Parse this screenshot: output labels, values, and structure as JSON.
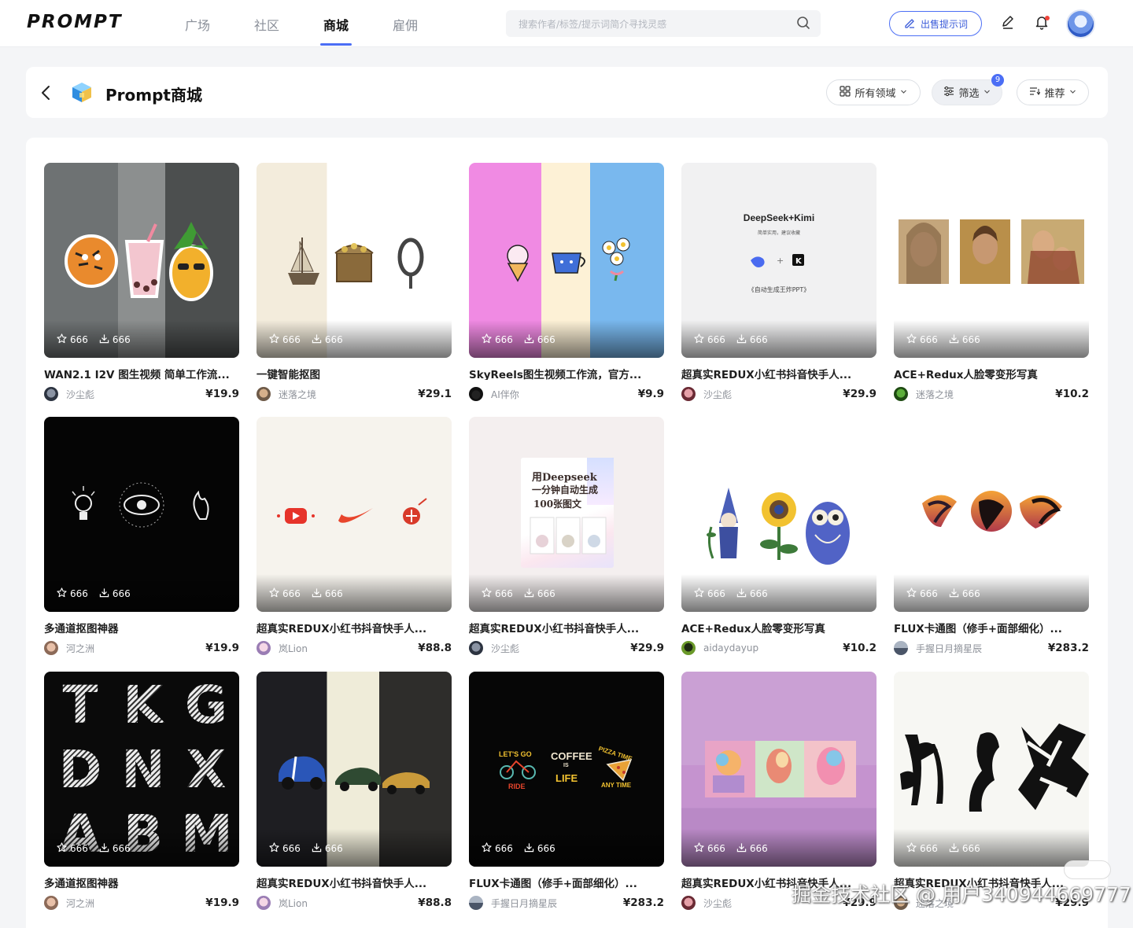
{
  "app": {
    "logo": "PROMPT"
  },
  "nav": {
    "tabs": [
      {
        "label": "广场",
        "active": false
      },
      {
        "label": "社区",
        "active": false
      },
      {
        "label": "商城",
        "active": true
      },
      {
        "label": "雇佣",
        "active": false
      }
    ],
    "search_placeholder": "搜索作者/标签/提示词简介寻找灵感",
    "sell_button": "出售提示词",
    "icons": [
      "pen-icon",
      "bell-icon"
    ]
  },
  "header": {
    "title": "Prompt商城",
    "domain_filter": "所有领域",
    "filter": "筛选",
    "filter_badge": "9",
    "sort": "推荐"
  },
  "colors": {
    "accent": "#4b6ef5",
    "price": "#1f1f1f"
  },
  "cards": [
    {
      "title": "WAN2.1 I2V 图生视频 简单工作流...",
      "author": "沙尘彪",
      "price": "¥19.9",
      "stars": "666",
      "downloads": "666"
    },
    {
      "title": "一键智能抠图",
      "author": "迷落之境",
      "price": "¥29.1",
      "stars": "666",
      "downloads": "666"
    },
    {
      "title": "SkyReels图生视频工作流，官方...",
      "author": "AI伴你",
      "price": "¥9.9",
      "stars": "666",
      "downloads": "666"
    },
    {
      "title": "超真实REDUX小红书抖音快手人...",
      "author": "沙尘彪",
      "price": "¥29.9",
      "stars": "666",
      "downloads": "666",
      "image_text": {
        "title": "DeepSeek+Kimi",
        "sub": "简单实用，建议收藏",
        "caption": "《自动生成王炸PPT》"
      }
    },
    {
      "title": "ACE+Redux人脸零变形写真",
      "author": "迷落之境",
      "price": "¥10.2",
      "stars": "666",
      "downloads": "666"
    },
    {
      "title": "多通道抠图神器",
      "author": "河之洲",
      "price": "¥19.9",
      "stars": "666",
      "downloads": "666"
    },
    {
      "title": "超真实REDUX小红书抖音快手人...",
      "author": "岚Lion",
      "price": "¥88.8",
      "stars": "666",
      "downloads": "666"
    },
    {
      "title": "超真实REDUX小红书抖音快手人...",
      "author": "沙尘彪",
      "price": "¥29.9",
      "stars": "666",
      "downloads": "666",
      "image_text": {
        "line1": "用Deepseek",
        "line2": "一分钟自动生成",
        "line3": "100张图文"
      }
    },
    {
      "title": "ACE+Redux人脸零变形写真",
      "author": "aidaydayup",
      "price": "¥10.2",
      "stars": "666",
      "downloads": "666"
    },
    {
      "title": "FLUX卡通图（修手+面部细化）...",
      "author": "手握日月摘星辰",
      "price": "¥283.2",
      "stars": "666",
      "downloads": "666"
    },
    {
      "title": "多通道抠图神器",
      "author": "河之洲",
      "price": "¥19.9",
      "stars": "666",
      "downloads": "666",
      "image_text": {
        "letters": "TKGDNXABM"
      }
    },
    {
      "title": "超真实REDUX小红书抖音快手人...",
      "author": "岚Lion",
      "price": "¥88.8",
      "stars": "666",
      "downloads": "666"
    },
    {
      "title": "FLUX卡通图（修手+面部细化）...",
      "author": "手握日月摘星辰",
      "price": "¥283.2",
      "stars": "666",
      "downloads": "666",
      "image_text": {
        "a": "LET'S GO",
        "b": "RIDE",
        "c": "COFFEE",
        "d": "IS",
        "e": "LIFE",
        "f": "PIZZA TIME",
        "g": "ANY TIME"
      }
    },
    {
      "title": "超真实REDUX小红书抖音快手人...",
      "author": "沙尘彪",
      "price": "¥29.9",
      "stars": "666",
      "downloads": "666"
    },
    {
      "title": "超真实REDUX小红书抖音快手人...",
      "author": "迷落之境",
      "price": "¥29.9",
      "stars": "666",
      "downloads": "666"
    }
  ],
  "watermark": "掘金技术社区 @ 用户340944669777"
}
